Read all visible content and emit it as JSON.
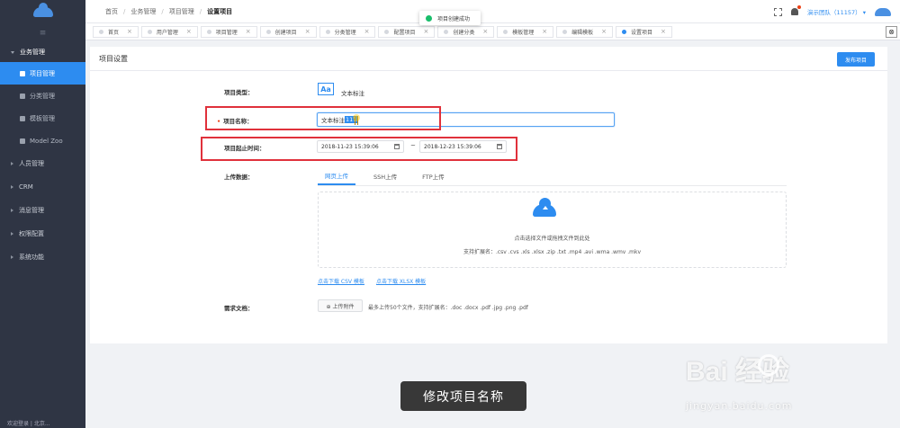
{
  "sidebar": {
    "groups": [
      {
        "label": "业务管理"
      },
      {
        "label": "人员管理"
      },
      {
        "label": "CRM"
      },
      {
        "label": "消息管理"
      },
      {
        "label": "权限配置"
      },
      {
        "label": "系统功能"
      }
    ],
    "items": [
      {
        "label": "项目管理"
      },
      {
        "label": "分类管理"
      },
      {
        "label": "模板管理"
      },
      {
        "label": "Model Zoo"
      }
    ],
    "bottom_text": "欢迎登录 | 北京..."
  },
  "header": {
    "breadcrumbs": [
      "首页",
      "业务管理",
      "项目管理",
      "设置项目"
    ],
    "team": "演示团队（11157）",
    "team_caret": "▾"
  },
  "tabs": [
    {
      "label": "首页"
    },
    {
      "label": "用户管理"
    },
    {
      "label": "项目管理"
    },
    {
      "label": "创建项目"
    },
    {
      "label": "分类管理"
    },
    {
      "label": "配置项目"
    },
    {
      "label": "创建分类"
    },
    {
      "label": "模板管理"
    },
    {
      "label": "编辑模板"
    },
    {
      "label": "设置项目"
    }
  ],
  "tab_close": "×",
  "tabs_close_all": "⊗",
  "toast": {
    "text": "项目创建成功"
  },
  "page": {
    "title": "项目设置",
    "publish": "发布项目",
    "type_label": "项目类型：",
    "type_icon_text": "Aa",
    "type_value": "文本标注",
    "required_mark": "•",
    "name_label": "项目名称：",
    "name_value_plain": "文本标注",
    "name_value_selected": "111",
    "time_label": "项目起止时间：",
    "start_time": "2018-11-23 15:39:06",
    "end_time": "2018-12-23 15:39:06",
    "range_sep": "~",
    "upload_label": "上传数据：",
    "upload_tabs": [
      "网页上传",
      "SSH上传",
      "FTP上传"
    ],
    "drop_hint": "点击选择文件或拖拽文件到此处",
    "drop_ext": "支持扩展名：.csv .cvs .xls .xlsx .zip .txt .mp4 .avi .wma .wmv .mkv",
    "csv_link": "点击下载 CSV 模板",
    "xlsx_link": "点击下载 XLSX 模板",
    "doc_label": "需求文档：",
    "attach_btn": "⊕ 上传附件",
    "attach_note": "最多上传50个文件，支持扩展名：.doc .docx .pdf .jpg .png .pdf"
  },
  "caption": "修改项目名称",
  "watermark": {
    "brand": "Bai  经验",
    "domain": "jingyan.baidu.com"
  }
}
